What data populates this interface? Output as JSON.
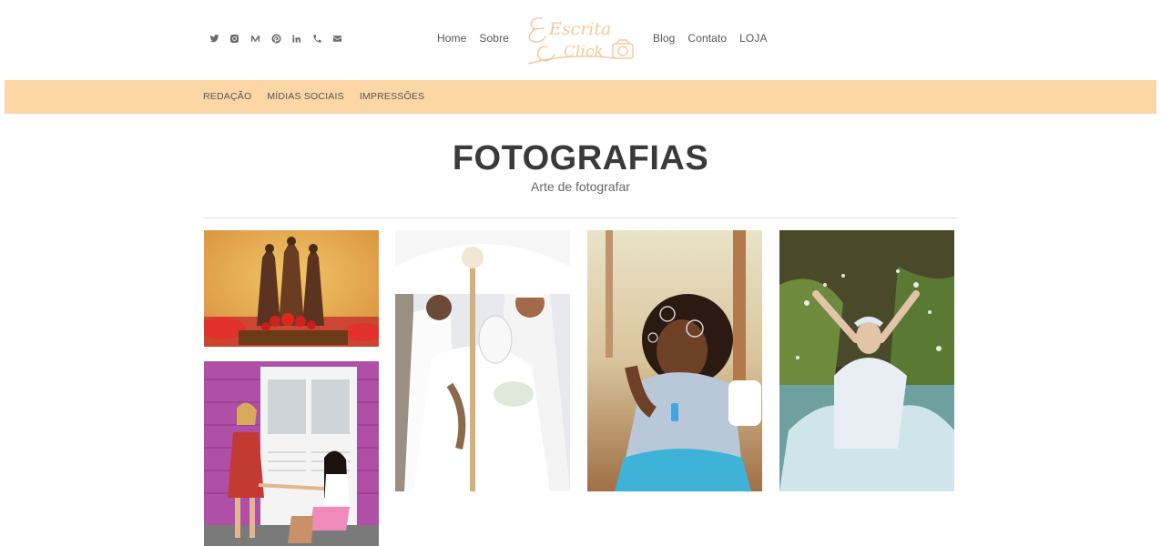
{
  "header": {
    "social_icons": [
      "twitter-icon",
      "instagram-icon",
      "medium-icon",
      "pinterest-icon",
      "linkedin-icon",
      "phone-icon",
      "envelope-icon"
    ],
    "nav_left": [
      "Home",
      "Sobre"
    ],
    "nav_right": [
      "Blog",
      "Contato",
      "LOJA"
    ],
    "logo_text_1": "Escrita",
    "logo_text_2": "Click",
    "logo_color": "#f5c89a"
  },
  "category_bar": {
    "color": "#fdd6a6",
    "items": [
      "REDAÇÃO",
      "MÍDIAS SOCIAIS",
      "IMPRESSÕES"
    ]
  },
  "page": {
    "title": "FOTOGRAFIAS",
    "subtitle": "Arte de fotografar"
  }
}
